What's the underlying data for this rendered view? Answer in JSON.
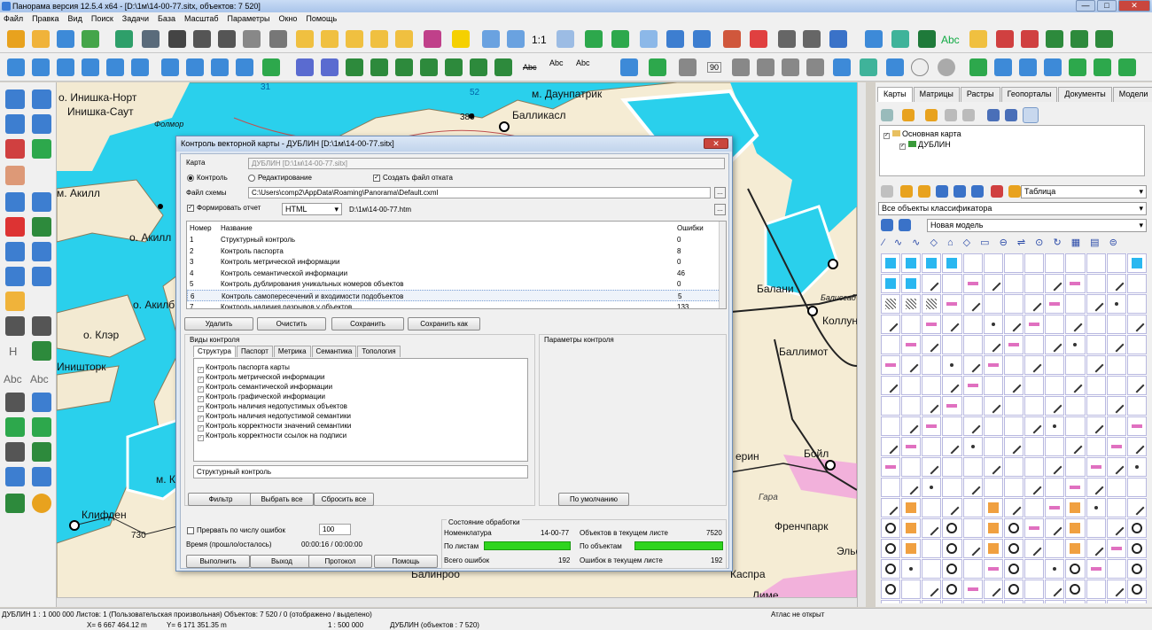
{
  "app": {
    "title": "Панорама версия 12.5.4 x64 - [D:\\1м\\14-00-77.sitx, объектов: 7 520]",
    "min": "—",
    "max": "□",
    "close": "✕"
  },
  "menu": [
    "Файл",
    "Правка",
    "Вид",
    "Поиск",
    "Задачи",
    "База",
    "Масштаб",
    "Параметры",
    "Окно",
    "Помощь"
  ],
  "toolbar_text": {
    "scale11": "1:1",
    "abc1": "Abc",
    "abc2": "Abc",
    "abc3": "Abc",
    "abc4": "Abc",
    "n90": "90"
  },
  "lefttool_text": {
    "h": "H",
    "abc1": "Abc",
    "abc2": "Abc"
  },
  "map_labels": [
    "о. Инишка-Норт",
    "Инишка-Саут",
    "Фолмор",
    "м. Даунпатрик",
    "Балликасл",
    "380",
    "м. Акилл",
    "о. Акилл",
    "о. Акилб",
    "о. Клэр",
    "Иништорк",
    "м. Клифден",
    "Клифден",
    "730",
    "Балинроо",
    "Баллимот",
    "Коллун",
    "Балиссад",
    "Балани",
    "Бойл",
    "ерин",
    "Френчпарк",
    "Эльф",
    "Каспра",
    "Лиме",
    "Гара",
    "31",
    "52"
  ],
  "right_panel": {
    "tabs": [
      "Карты",
      "Матрицы",
      "Растры",
      "Геопорталы",
      "Документы",
      "Модели"
    ],
    "tree": [
      "Основная карта",
      "ДУБЛИН"
    ],
    "view_combo": "Таблица",
    "objects_combo": "Все объекты классификатора",
    "model_combo": "Новая модель"
  },
  "status": {
    "line1": "ДУБЛИН  1 : 1 000 000  Листов: 1  (Пользовательская произвольная)  Объектов: 7 520 / 0 (отображено / выделено)",
    "atlas": "Атлас не открыт",
    "x": "X= 6 667 464.12 m",
    "y": "Y= 6 171 351.35 m",
    "scale": "1 : 500 000",
    "map": "ДУБЛИН  (объектов : 7 520)"
  },
  "dialog": {
    "title": "Контроль векторной карты - ДУБЛИН [D:\\1м\\14-00-77.sitx]",
    "close": "✕",
    "map_label": "Карта",
    "map_value": "ДУБЛИН [D:\\1м\\14-00-77.sitx]",
    "mode_control": "Контроль",
    "mode_edit": "Редактирование",
    "create_backup": "Создать файл отката",
    "scheme_label": "Файл схемы",
    "scheme_value": "C:\\Users\\comp2\\AppData\\Roaming\\Panorama\\Default.cxml",
    "report_label": "Формировать отчет",
    "report_format": "HTML",
    "report_path": "D:\\1м\\14-00-77.htm",
    "dots": "...",
    "table_headers": {
      "num": "Номер",
      "name": "Название",
      "errors": "Ошибки"
    },
    "rows": [
      {
        "num": "1",
        "name": "Структурный контроль",
        "errors": "0"
      },
      {
        "num": "2",
        "name": "Контроль паспорта",
        "errors": "8"
      },
      {
        "num": "3",
        "name": "Контроль метрической информации",
        "errors": "0"
      },
      {
        "num": "4",
        "name": "Контроль семантической информации",
        "errors": "46"
      },
      {
        "num": "5",
        "name": "Контроль дублирования уникальных номеров объектов",
        "errors": "0"
      },
      {
        "num": "6",
        "name": "Контроль самопересечений и входимости подобъектов",
        "errors": "5"
      },
      {
        "num": "7",
        "name": "Контроль наличия разрывов у объектов",
        "errors": "133"
      }
    ],
    "btn_delete": "Удалить",
    "btn_clear": "Очистить",
    "btn_save": "Сохранить",
    "btn_saveas": "Сохранить как",
    "kinds_label": "Виды контроля",
    "params_label": "Параметры контроля",
    "tabs": [
      "Структура",
      "Паспорт",
      "Метрика",
      "Семантика",
      "Топология"
    ],
    "checks": [
      "Контроль паспорта карты",
      "Контроль метрической информации",
      "Контроль семантической информации",
      "Контроль графической информации",
      "Контроль наличия недопустимых объектов",
      "Контроль наличия недопустимой семантики",
      "Контроль корректности значений семантики",
      "Контроль корректности ссылок на подписи"
    ],
    "structural": "Структурный контроль",
    "btn_filter": "Фильтр",
    "btn_selectall": "Выбрать все",
    "btn_reset": "Сбросить все",
    "btn_default": "По умолчанию",
    "interrupt_label": "Прервать по числу ошибок",
    "interrupt_value": "100",
    "time_label": "Время (прошло/осталось)",
    "time_value": "00:00:16 / 00:00:00",
    "state_label": "Состояние обработки",
    "nomen_label": "Номенклатура",
    "nomen_value": "14-00-77",
    "sheets_label": "По листам",
    "objects_label": "По объектам",
    "total_label": "Всего ошибок",
    "total_value": "192",
    "obj_sheet_label": "Объектов в текущем листе",
    "obj_sheet_value": "7520",
    "err_sheet_label": "Ошибок в текущем листе",
    "err_sheet_value": "192",
    "btn_run": "Выполнить",
    "btn_exit": "Выход",
    "btn_protocol": "Протокол",
    "btn_help": "Помощь"
  }
}
